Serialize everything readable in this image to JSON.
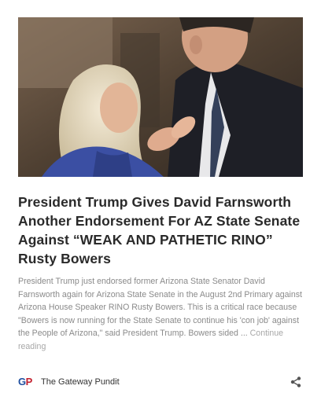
{
  "article": {
    "headline": "President Trump Gives David Farnsworth Another Endorsement For AZ State Senate Against “WEAK AND PATHETIC RINO” Rusty Bowers",
    "excerpt": "President Trump just endorsed former Arizona State Senator David Farnsworth again for Arizona State Senate in the August 2nd Primary against Arizona House Speaker RINO Rusty Bowers. This is a critical race because \"Bowers is now running for the State Senate to continue his 'con job' against the People of Arizona,\" said President Trump.  Bowers sided ... ",
    "continue_label": "Continue reading"
  },
  "footer": {
    "logo_g": "G",
    "logo_p": "P",
    "source_name": "The Gateway Pundit",
    "share_icon": "share-icon"
  },
  "colors": {
    "headline": "#2a2a2a",
    "excerpt": "#8a8a8a",
    "logo_blue": "#1f4fa0",
    "logo_red": "#c21f2d"
  }
}
